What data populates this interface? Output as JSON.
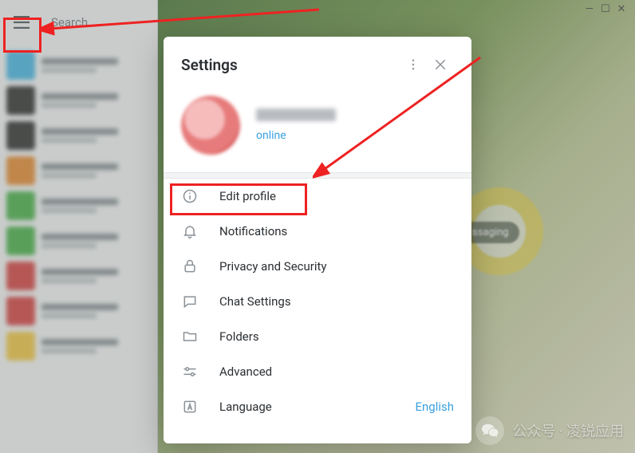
{
  "window": {
    "minimize_glyph": "—",
    "maximize_glyph": "☐",
    "close_glyph": "✕"
  },
  "topbar": {
    "search_placeholder": "Search"
  },
  "chat_avatars": [
    "#4fb9e6",
    "#3a3a3a",
    "#3a3a3a",
    "#e78f3a",
    "#50b350",
    "#50b350",
    "#d84a4a",
    "#d84a4a",
    "#f2c94c"
  ],
  "background": {
    "badge_text": "ssaging"
  },
  "settings": {
    "title": "Settings",
    "status": "online",
    "menu": [
      {
        "icon": "info",
        "label": "Edit profile"
      },
      {
        "icon": "bell",
        "label": "Notifications"
      },
      {
        "icon": "lock",
        "label": "Privacy and Security"
      },
      {
        "icon": "chat",
        "label": "Chat Settings"
      },
      {
        "icon": "folder",
        "label": "Folders"
      },
      {
        "icon": "advanced",
        "label": "Advanced"
      },
      {
        "icon": "language",
        "label": "Language",
        "value": "English"
      }
    ]
  },
  "watermark": {
    "text": "公众号 · 凌锐应用"
  }
}
